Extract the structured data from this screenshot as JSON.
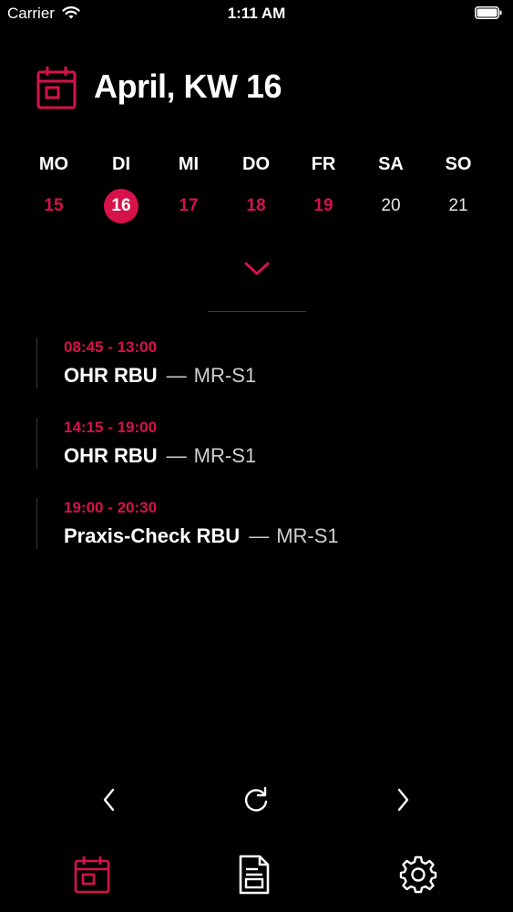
{
  "status_bar": {
    "carrier": "Carrier",
    "time": "1:11 AM"
  },
  "header": {
    "title": "April, KW 16",
    "icon": "calendar-icon"
  },
  "week": {
    "days": [
      {
        "name": "MO",
        "number": "15",
        "state": "weekday"
      },
      {
        "name": "DI",
        "number": "16",
        "state": "selected"
      },
      {
        "name": "MI",
        "number": "17",
        "state": "weekday"
      },
      {
        "name": "DO",
        "number": "18",
        "state": "weekday"
      },
      {
        "name": "FR",
        "number": "19",
        "state": "weekday"
      },
      {
        "name": "SA",
        "number": "20",
        "state": "weekend"
      },
      {
        "name": "SO",
        "number": "21",
        "state": "weekend"
      }
    ],
    "expand_icon": "chevron-down-icon"
  },
  "events": [
    {
      "time": "08:45 - 13:00",
      "title": "OHR RBU",
      "separator": "—",
      "room": "MR-S1"
    },
    {
      "time": "14:15 - 19:00",
      "title": "OHR RBU",
      "separator": "—",
      "room": "MR-S1"
    },
    {
      "time": "19:00 - 20:30",
      "title": "Praxis-Check RBU",
      "separator": "—",
      "room": "MR-S1"
    }
  ],
  "navigation": {
    "previous_icon": "chevron-left-icon",
    "refresh_icon": "refresh-icon",
    "next_icon": "chevron-right-icon"
  },
  "tab_bar": {
    "tabs": [
      {
        "icon": "calendar-icon",
        "active": true
      },
      {
        "icon": "document-icon",
        "active": false
      },
      {
        "icon": "gear-icon",
        "active": false
      }
    ]
  },
  "colors": {
    "accent": "#d6124a",
    "background": "#000000",
    "text": "#ffffff",
    "muted": "#cfcfcf"
  }
}
